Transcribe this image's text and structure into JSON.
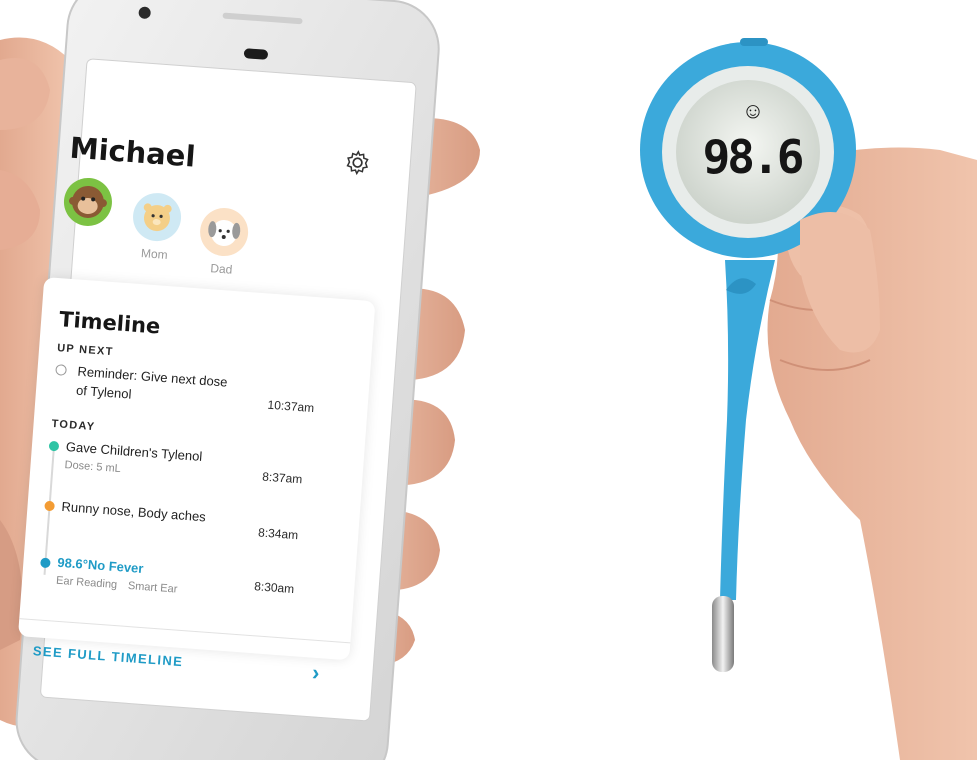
{
  "app": {
    "profile_name": "Michael",
    "family": [
      {
        "name": "",
        "icon": "monkey-icon",
        "color": "#7cc243"
      },
      {
        "name": "Mom",
        "icon": "bear-icon",
        "color": "#cfe9f4"
      },
      {
        "name": "Dad",
        "icon": "dog-icon",
        "color": "#fbe1c6"
      }
    ],
    "settings_icon": "gear-icon",
    "timeline": {
      "title": "Timeline",
      "up_next_label": "UP NEXT",
      "up_next": {
        "line1": "Reminder: Give next dose",
        "line2": "of Tylenol",
        "time": "10:37am"
      },
      "today_label": "TODAY",
      "today": [
        {
          "text": "Gave Children's Tylenol",
          "sub": "Dose: 5 mL",
          "time": "8:37am",
          "color": "#2ec4a4"
        },
        {
          "text": "Runny nose, Body aches",
          "time": "8:34am",
          "color": "#f39c34"
        },
        {
          "text": "98.6°No Fever",
          "sub": "Ear Reading",
          "sub2": "Smart Ear",
          "time": "8:30am",
          "color": "#1f9bc6"
        }
      ],
      "see_full": "SEE FULL TIMELINE"
    }
  },
  "thermometer": {
    "reading": "98.6",
    "face": "☺",
    "body_color": "#3ba9db"
  },
  "colors": {
    "accent": "#1f9bc6"
  }
}
